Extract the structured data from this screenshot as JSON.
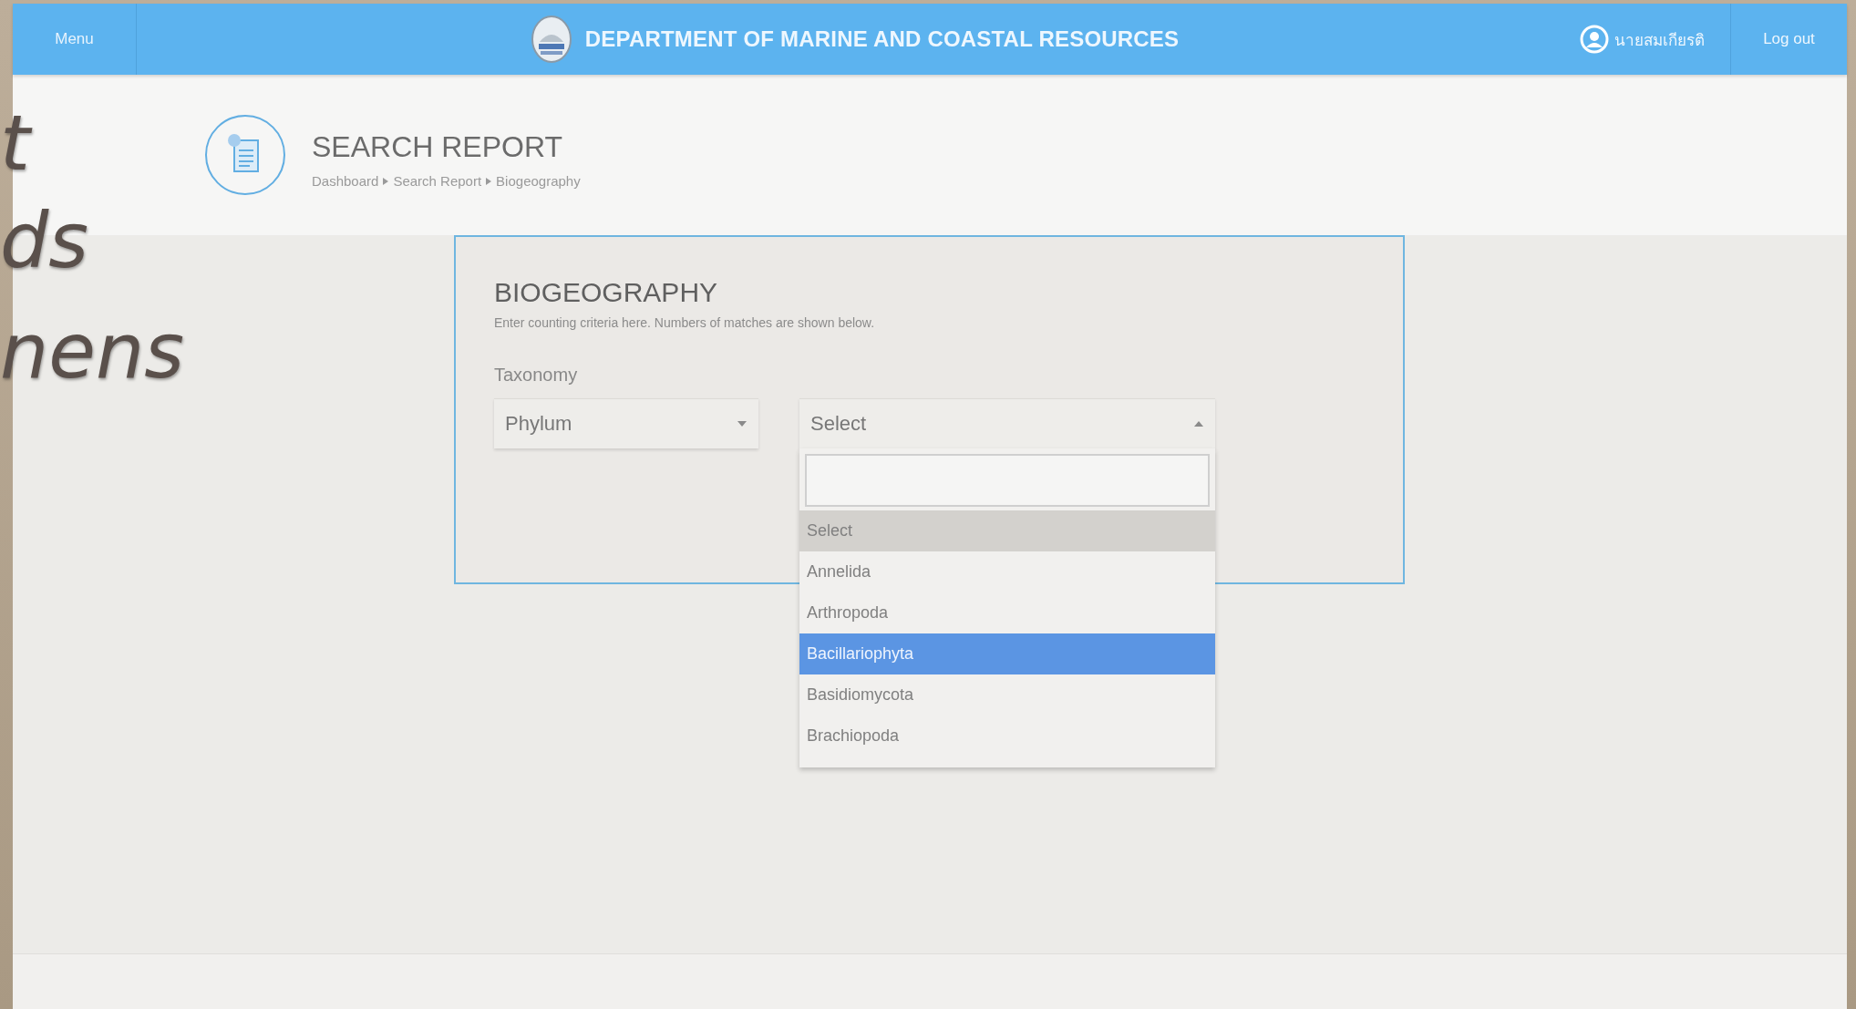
{
  "slide_text": [
    "t",
    "ds",
    "nens"
  ],
  "header": {
    "menu": "Menu",
    "title": "DEPARTMENT OF MARINE AND COASTAL RESOURCES",
    "user_name": "นายสมเกียรติ",
    "logout": "Log out"
  },
  "page": {
    "title": "SEARCH REPORT",
    "breadcrumb": [
      "Dashboard",
      "Search Report",
      "Biogeography"
    ]
  },
  "card": {
    "title": "BIOGEOGRAPHY",
    "description": "Enter counting criteria here. Numbers of matches are shown below.",
    "field_label": "Taxonomy",
    "selects": [
      {
        "value": "Phylum",
        "open": false
      },
      {
        "value": "Select",
        "open": true
      }
    ],
    "options": [
      {
        "label": "Select",
        "selected": true,
        "hovered": false
      },
      {
        "label": "Annelida",
        "selected": false,
        "hovered": false
      },
      {
        "label": "Arthropoda",
        "selected": false,
        "hovered": false
      },
      {
        "label": "Bacillariophyta",
        "selected": false,
        "hovered": true
      },
      {
        "label": "Basidiomycota",
        "selected": false,
        "hovered": false
      },
      {
        "label": "Brachiopoda",
        "selected": false,
        "hovered": false
      }
    ]
  }
}
